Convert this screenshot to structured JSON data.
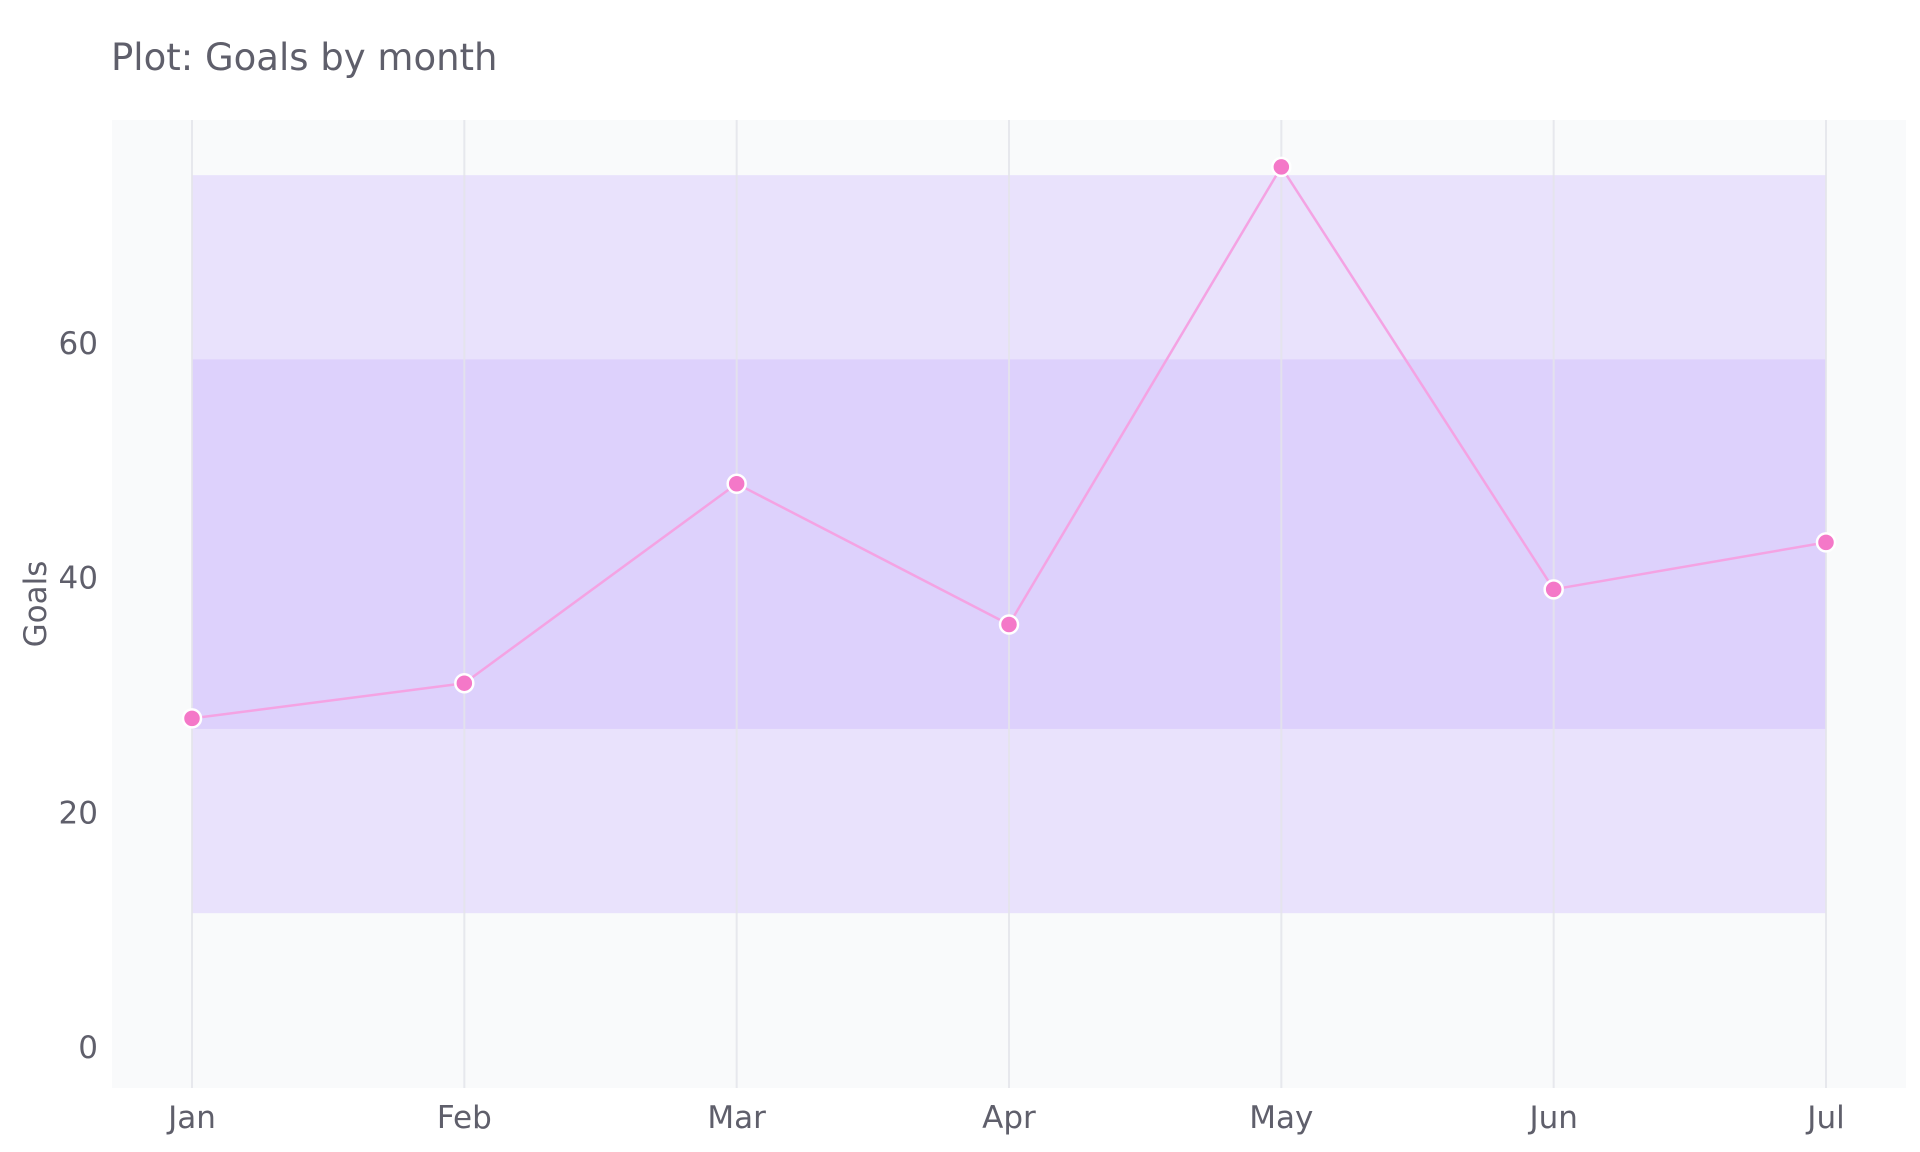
{
  "chart_data": {
    "type": "line",
    "title": "Plot: Goals by month",
    "xlabel": "",
    "ylabel": "Goals",
    "categories": [
      "Jan",
      "Feb",
      "Mar",
      "Apr",
      "May",
      "Jun",
      "Jul"
    ],
    "series": [
      {
        "values": [
          28,
          31,
          48,
          36,
          75,
          39,
          43
        ]
      }
    ],
    "ylim": [
      -3.5,
      79
    ],
    "yticks": [
      0,
      20,
      40,
      60
    ],
    "bands": [
      {
        "y0": 11.4,
        "y1": 74.3
      },
      {
        "y0": 27.1,
        "y1": 58.6
      }
    ],
    "grid": {
      "x": true,
      "y": false
    },
    "colors": {
      "line": "#f4a3e3",
      "marker": "#f478c8",
      "marker_edge": "#ffffff",
      "band_outer": "#e9e2fc",
      "band_inner": "#ddd1fc",
      "plot_bg": "#f9fafb",
      "gridline": "#e4e4ea",
      "text": "#5f5f6b"
    }
  }
}
